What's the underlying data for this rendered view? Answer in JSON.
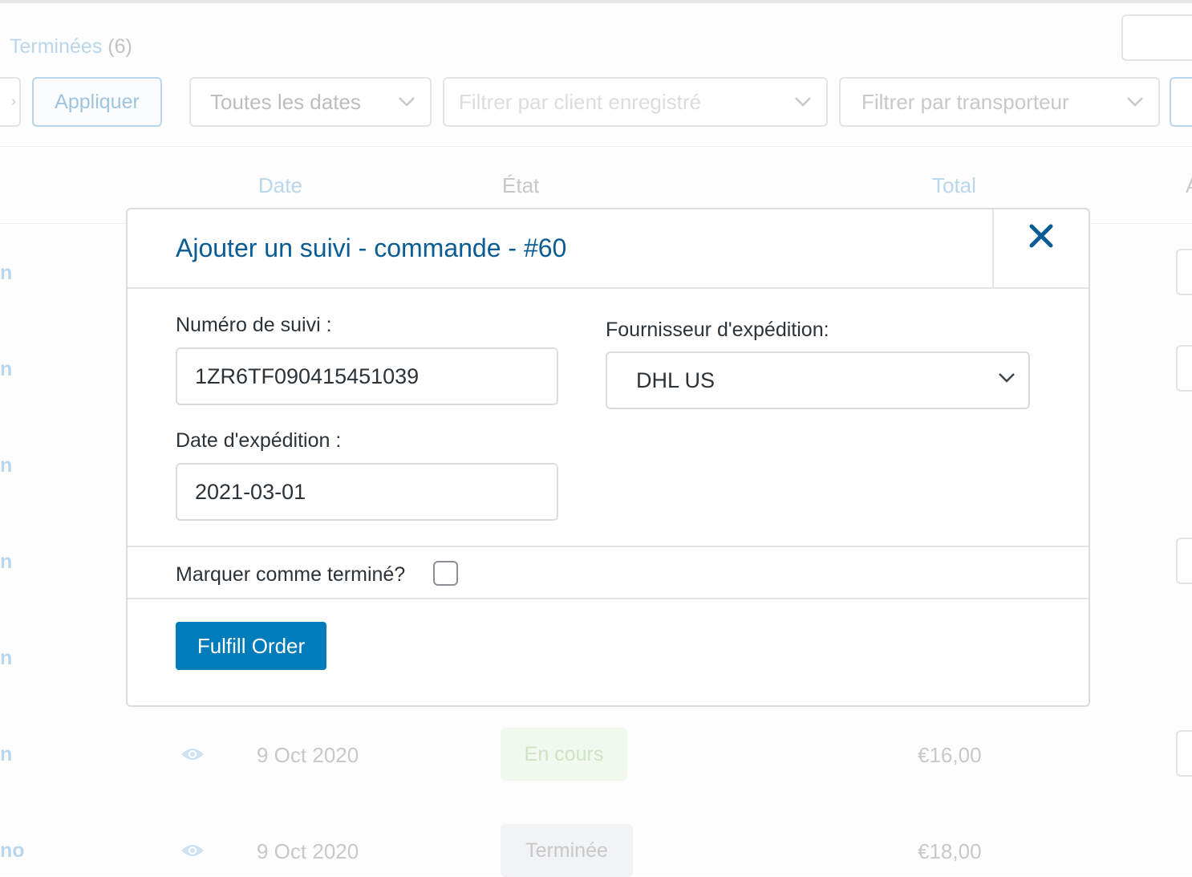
{
  "background": {
    "subsubsub": {
      "label": "Terminées",
      "count": "(6)"
    },
    "filters": {
      "apply_label": "Appliquer",
      "dates_label": "Toutes les dates",
      "client_placeholder": "Filtrer par client enregistré",
      "carrier_label": "Filtrer par transporteur"
    },
    "table_headers": {
      "date": "Date",
      "state": "État",
      "total": "Total"
    },
    "row_fragments": [
      "n",
      "n",
      "n",
      "n",
      "n",
      "n",
      "no"
    ],
    "rows": [
      {
        "date": "9 Oct 2020",
        "status": "En cours",
        "total": "€16,00"
      },
      {
        "date": "9 Oct 2020",
        "status": "Terminée",
        "total": "€18,00"
      }
    ]
  },
  "modal": {
    "title": "Ajouter un suivi - commande - #60",
    "tracking_number_label": "Numéro de suivi :",
    "tracking_number_value": "1ZR6TF090415451039",
    "provider_label": "Fournisseur d'expédition:",
    "provider_value": "DHL US",
    "ship_date_label": "Date d'expédition :",
    "ship_date_value": "2021-03-01",
    "mark_complete_label": "Marquer comme terminé?",
    "mark_complete_checked": false,
    "submit_label": "Fulfill Order"
  },
  "colors": {
    "accent": "#007cba",
    "title": "#0a5c94",
    "processing_bg": "#c6e1c6",
    "completed_bg": "#e5e5e5"
  }
}
